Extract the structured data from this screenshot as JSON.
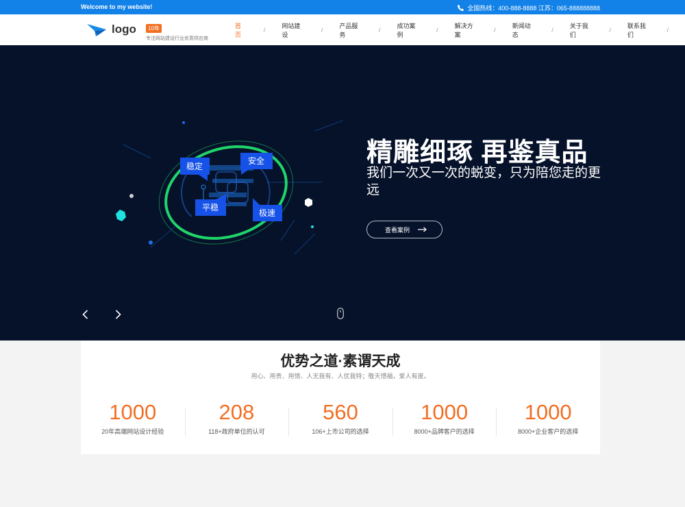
{
  "topbar": {
    "welcome": "Welcome to my website!",
    "hotline": "全国热线：400-888-8888 江苏：065-888888888"
  },
  "header": {
    "logo_text": "logo",
    "years_badge": "10年",
    "slogan": "专注网站建设行业优质供应商"
  },
  "nav": {
    "items": [
      {
        "label": "首页"
      },
      {
        "label": "网站建设"
      },
      {
        "label": "产品服务"
      },
      {
        "label": "成功案例"
      },
      {
        "label": "解决方案"
      },
      {
        "label": "新闻动态"
      },
      {
        "label": "关于我们"
      },
      {
        "label": "联系我们"
      }
    ],
    "separator": "/"
  },
  "hero": {
    "title": "精雕细琢 再鉴真品",
    "subtitle": "我们一次又一次的蜕变，只为陪您走的更远",
    "button_label": "查看案例",
    "badges": [
      "稳定",
      "安全",
      "平稳",
      "极速"
    ]
  },
  "advantages": {
    "title": "优势之道·素谓天成",
    "subtitle": "用心、用责、用情、人无我有、人优我特；敬天惜福，爱人有度。",
    "stats": [
      {
        "value": "1000",
        "label": "20年高端网站设计经验"
      },
      {
        "value": "208",
        "label": "118+政府单位的认可"
      },
      {
        "value": "560",
        "label": "106+上市公司的选择"
      },
      {
        "value": "1000",
        "label": "8000+品牌客户的选择"
      },
      {
        "value": "1000",
        "label": "8000+企业客户的选择"
      }
    ]
  },
  "colors": {
    "topbar": "#1281e8",
    "accent": "#f26e22",
    "hero_bg": "#06122a",
    "badge_blue": "#1652e8",
    "ring_green": "#1fd66a"
  }
}
